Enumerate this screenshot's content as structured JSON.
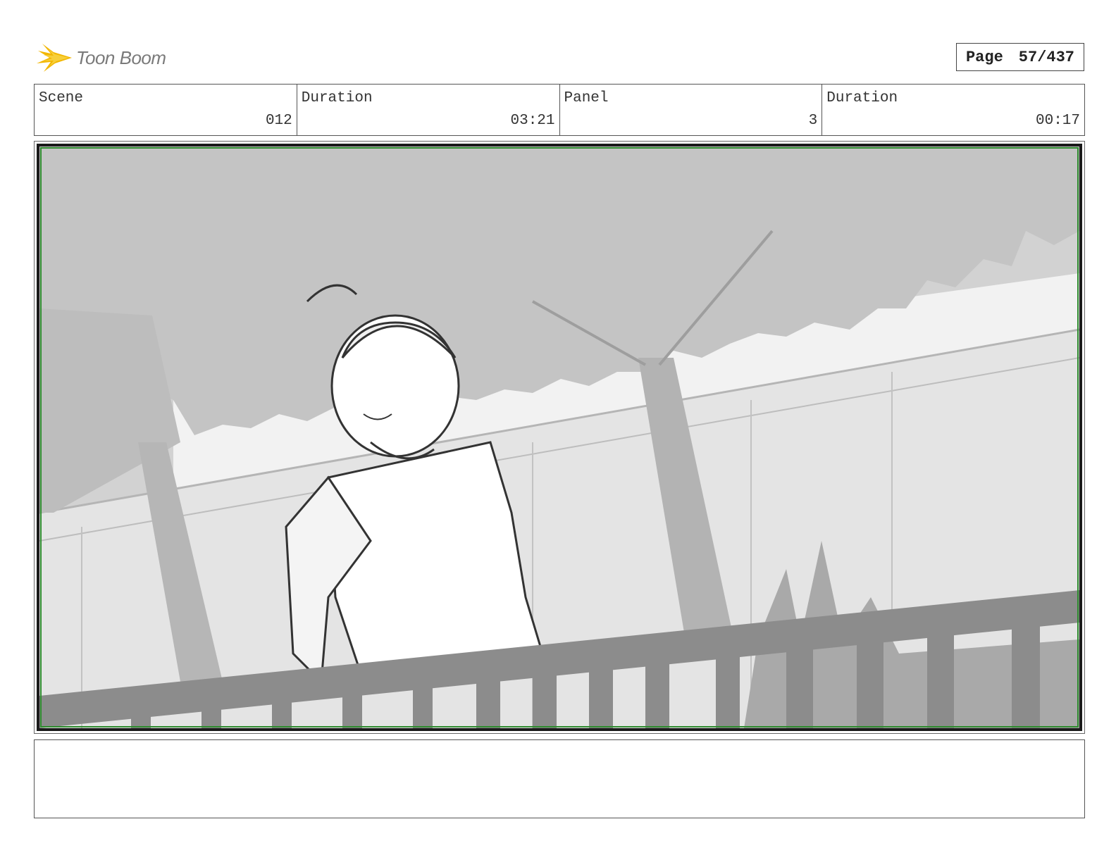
{
  "header": {
    "logo_text": "Toon Boom",
    "page_label": "Page",
    "page_value": "57/437"
  },
  "info": {
    "scene_label": "Scene",
    "scene_value": "012",
    "scene_duration_label": "Duration",
    "scene_duration_value": "03:21",
    "panel_label": "Panel",
    "panel_value": "3",
    "panel_duration_label": "Duration",
    "panel_duration_value": "00:17"
  },
  "colors": {
    "logo_accent": "#f2b600",
    "frame_border": "#1a1a1a",
    "frame_inner": "#2e8b2e"
  },
  "notes": {
    "text": ""
  }
}
